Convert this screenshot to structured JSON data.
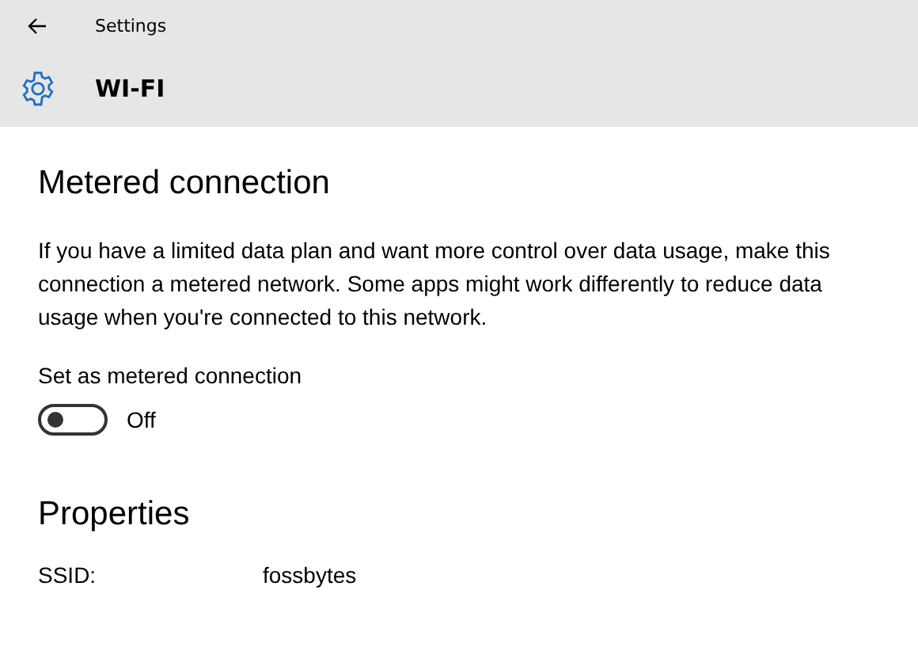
{
  "window": {
    "title": "Settings"
  },
  "header": {
    "title": "WI-FI"
  },
  "metered": {
    "heading": "Metered connection",
    "description": "If you have a limited data plan and want more control over data usage, make this connection a metered network. Some apps might work differently to reduce data usage when you're connected to this network.",
    "toggle_label": "Set as metered connection",
    "toggle": {
      "on": false,
      "state_text": "Off"
    }
  },
  "properties": {
    "heading": "Properties",
    "rows": [
      {
        "label": "SSID:",
        "value": "fossbytes"
      }
    ]
  }
}
